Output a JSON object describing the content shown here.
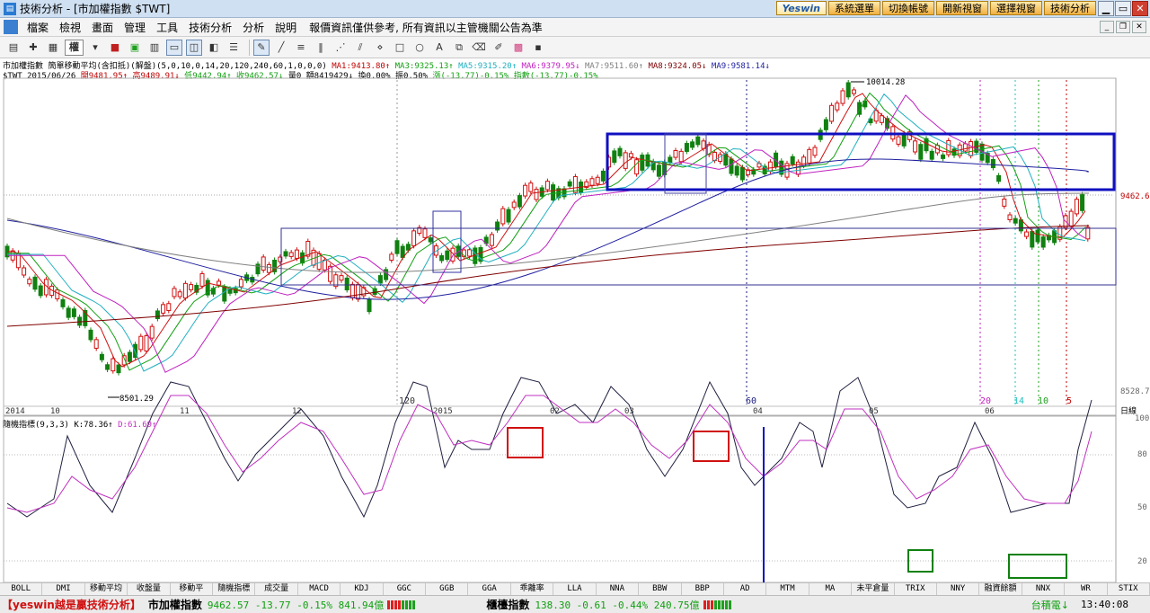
{
  "window": {
    "title": "技術分析 - [市加權指數 $TWT]",
    "app_icon": "chart-app-icon"
  },
  "ribbon": {
    "brand": "Yeswin",
    "buttons": [
      "系統選單",
      "切換帳號",
      "開新視窗",
      "選擇視窗",
      "技術分析"
    ]
  },
  "menu": {
    "items": [
      "檔案",
      "檢視",
      "畫面",
      "管理",
      "工具",
      "技術分析",
      "分析",
      "說明"
    ],
    "notice": "報價資訊僅供參考, 所有資訊以主管機關公告為準"
  },
  "toolbar": {
    "weight_label": "權"
  },
  "info": {
    "line1_name": "市加權指數",
    "line1_ind": "簡單移動平均(含扣抵)(解盤)(5,0,10,0,14,20,120,240,60,1,0,0,0)",
    "ma1": "MA1:9413.80↑",
    "ma3": "MA3:9325.13↑",
    "ma5": "MA5:9315.20↑",
    "ma6": "MA6:9379.95↓",
    "ma7": "MA7:9511.60↑",
    "ma8": "MA8:9324.05↓",
    "ma9": "MA9:9581.14↓",
    "line2": "$TWT 2015/06/26",
    "open": "開9481.95↑",
    "high": "高9489.91↓",
    "low": "低9442.94↑",
    "close": "收9462.57↓",
    "vol": "量0 額8419429↓",
    "turnover": "換0.00% 振0.50%",
    "change": "漲(-13.77)-0.15%",
    "idx": "指數(-13.77)-0.15%",
    "stoch": "隨機指標(9,3,3) K:78.36↑",
    "stoch_d": "D:61.69↑"
  },
  "price_axis": {
    "high_label": "10014.28",
    "low_label": "8501.29",
    "last": "9462.6",
    "bottom": "8528.7",
    "unit": "日線"
  },
  "date_axis": [
    "2014",
    "10",
    "11",
    "12",
    "2015",
    "02",
    "03",
    "04",
    "05",
    "06"
  ],
  "date_markers": [
    "120",
    "60",
    "20",
    "14",
    "10",
    "5"
  ],
  "stoch_axis": [
    "100",
    "80",
    "50",
    "20"
  ],
  "indicators": [
    "BOLL",
    "DMI",
    "移動平均",
    "收盤量",
    "移動平",
    "隨機指標",
    "成交量",
    "MACD",
    "KDJ",
    "GGC",
    "GGB",
    "GGA",
    "乖離率",
    "LLA",
    "NNA",
    "BBW",
    "BBP",
    "AD",
    "MTM",
    "MA",
    "未平倉量",
    "TRIX",
    "NNY",
    "融資餘額",
    "NNX",
    "WR",
    "STIX"
  ],
  "status": {
    "brand": "【yeswin越是贏技術分析】",
    "idx1_name": "市加權指數",
    "idx1_vals": "9462.57 -13.77 -0.15% 841.94億",
    "idx2_name": "櫃檯指數",
    "idx2_vals": "138.30 -0.61 -0.44% 240.75億",
    "stock": "台積電↓",
    "time": "13:40:08"
  },
  "chart_data": {
    "type": "candlestick",
    "price_range": [
      8501.29,
      10014.28
    ],
    "annotations": [
      "10014.28",
      "8501.29"
    ],
    "stochastic_k_last": 78.36,
    "stochastic_d_last": 61.69
  }
}
